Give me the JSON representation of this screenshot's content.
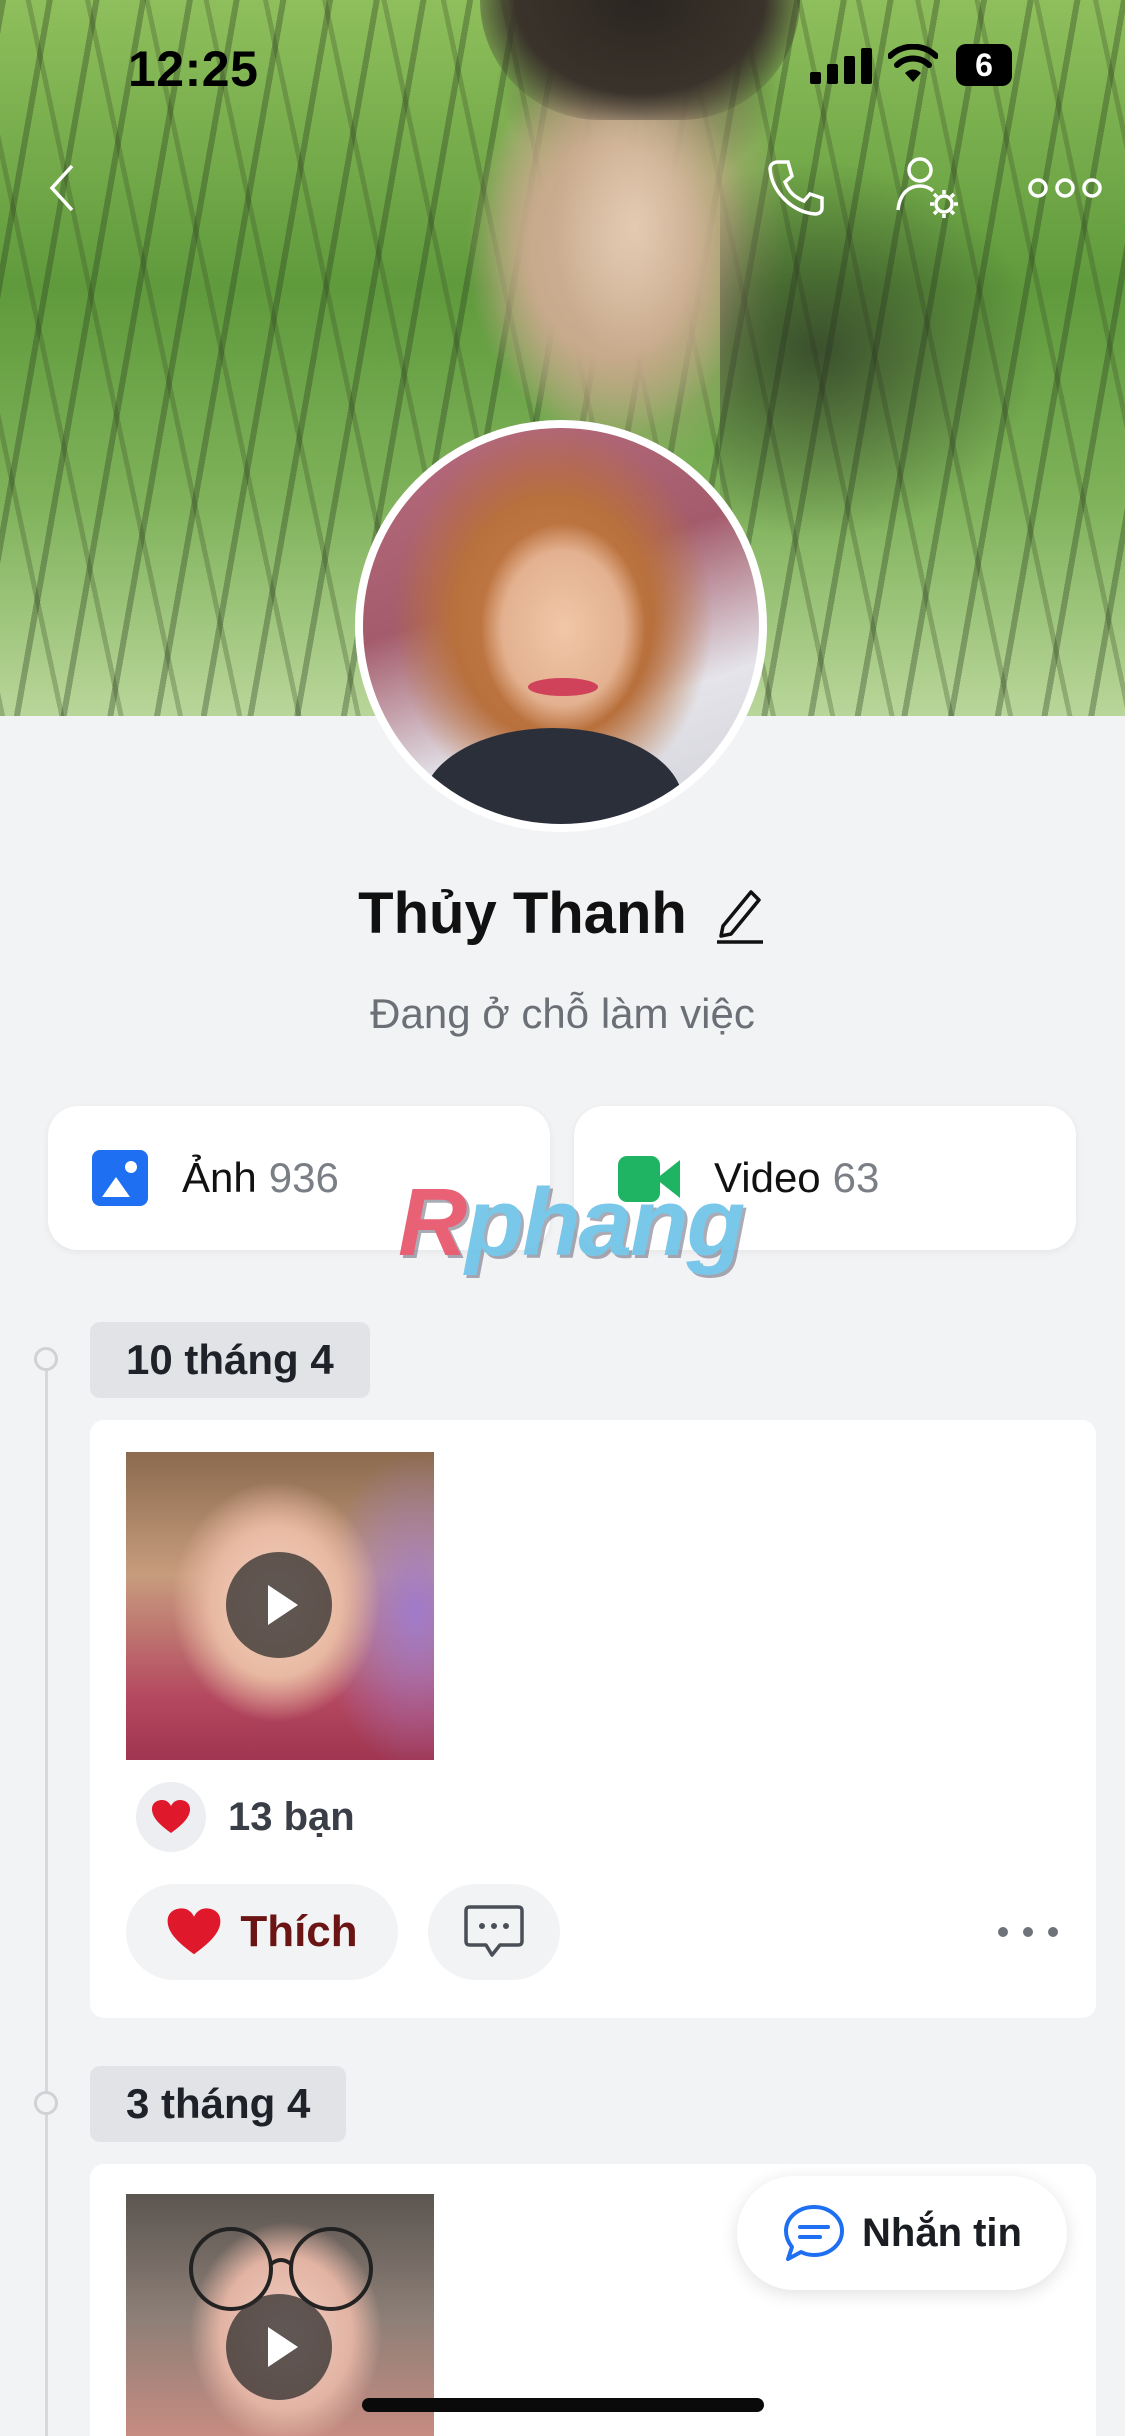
{
  "status_bar": {
    "time": "12:25",
    "battery": "6"
  },
  "header": {
    "back_icon": "chevron-left-icon",
    "call_icon": "phone-icon",
    "settings_icon": "user-settings-icon",
    "more_icon": "more-horizontal-icon"
  },
  "profile": {
    "name": "Thủy Thanh",
    "status": "Đang ở chỗ làm việc"
  },
  "media": {
    "photos_label": "Ảnh",
    "photos_count": "936",
    "videos_label": "Video",
    "videos_count": "63"
  },
  "watermark": {
    "first": "R",
    "rest": "phang"
  },
  "timeline": [
    {
      "date": "10 tháng 4",
      "likes": "13 bạn",
      "like_label": "Thích"
    },
    {
      "date": "3 tháng 4"
    }
  ],
  "fab": {
    "label": "Nhắn tin"
  },
  "colors": {
    "accent": "#1f6ff2",
    "video_green": "#1fb364",
    "like_red": "#e0182c"
  }
}
